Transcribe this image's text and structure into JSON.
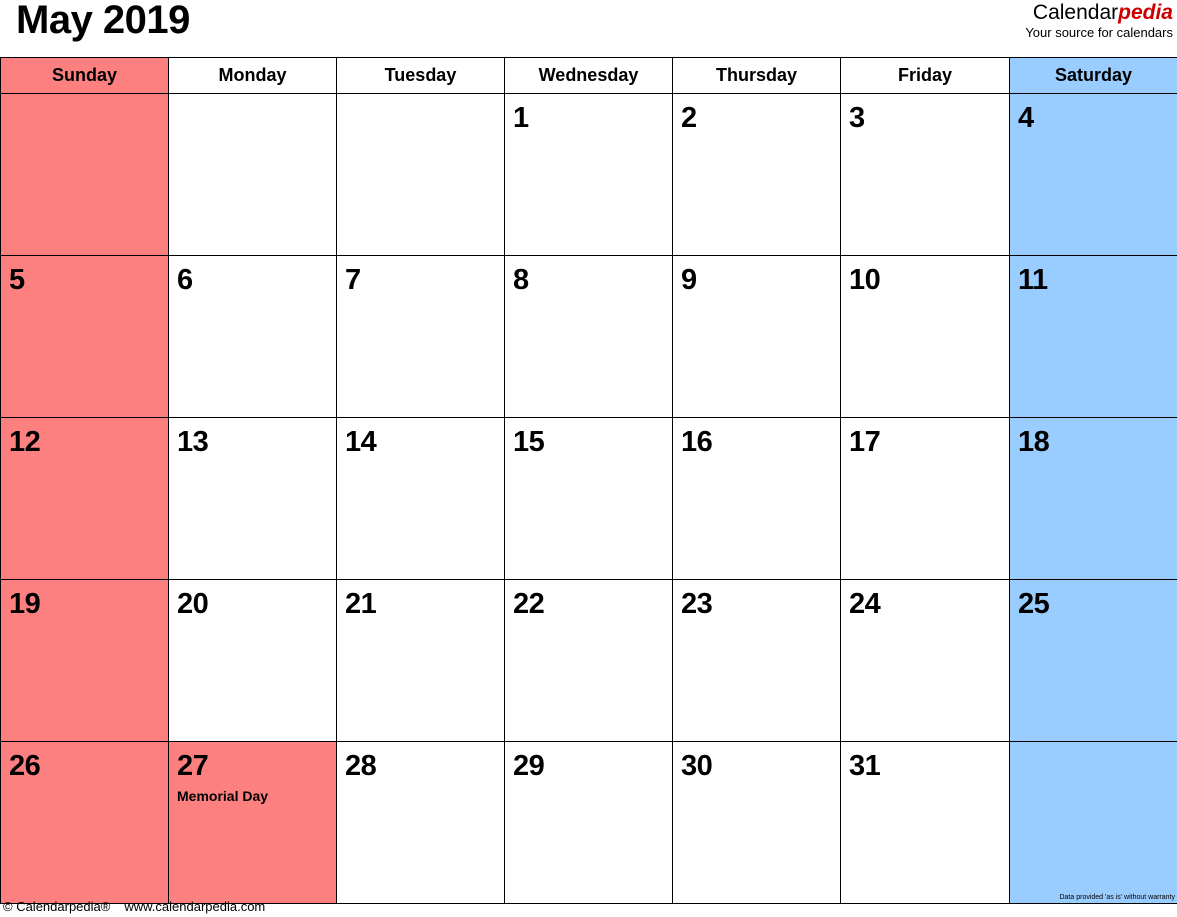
{
  "header": {
    "title": "May 2019",
    "brand_part1": "Calendar",
    "brand_part2": "pedia",
    "tagline": "Your source for calendars"
  },
  "colors": {
    "weekend_red": "#fd8080",
    "saturday_blue": "#99ccff",
    "brand_red": "#cc0000",
    "text": "#000000",
    "border": "#000000"
  },
  "calendar": {
    "month": "May",
    "year": "2019",
    "weekdays": [
      "Sunday",
      "Monday",
      "Tuesday",
      "Wednesday",
      "Thursday",
      "Friday",
      "Saturday"
    ],
    "weeks": [
      [
        {
          "day": "",
          "event": ""
        },
        {
          "day": "",
          "event": ""
        },
        {
          "day": "",
          "event": ""
        },
        {
          "day": "1",
          "event": ""
        },
        {
          "day": "2",
          "event": ""
        },
        {
          "day": "3",
          "event": ""
        },
        {
          "day": "4",
          "event": ""
        }
      ],
      [
        {
          "day": "5",
          "event": ""
        },
        {
          "day": "6",
          "event": ""
        },
        {
          "day": "7",
          "event": ""
        },
        {
          "day": "8",
          "event": ""
        },
        {
          "day": "9",
          "event": ""
        },
        {
          "day": "10",
          "event": ""
        },
        {
          "day": "11",
          "event": ""
        }
      ],
      [
        {
          "day": "12",
          "event": ""
        },
        {
          "day": "13",
          "event": ""
        },
        {
          "day": "14",
          "event": ""
        },
        {
          "day": "15",
          "event": ""
        },
        {
          "day": "16",
          "event": ""
        },
        {
          "day": "17",
          "event": ""
        },
        {
          "day": "18",
          "event": ""
        }
      ],
      [
        {
          "day": "19",
          "event": ""
        },
        {
          "day": "20",
          "event": ""
        },
        {
          "day": "21",
          "event": ""
        },
        {
          "day": "22",
          "event": ""
        },
        {
          "day": "23",
          "event": ""
        },
        {
          "day": "24",
          "event": ""
        },
        {
          "day": "25",
          "event": ""
        }
      ],
      [
        {
          "day": "26",
          "event": ""
        },
        {
          "day": "27",
          "event": "Memorial Day"
        },
        {
          "day": "28",
          "event": ""
        },
        {
          "day": "29",
          "event": ""
        },
        {
          "day": "30",
          "event": ""
        },
        {
          "day": "31",
          "event": ""
        },
        {
          "day": "",
          "event": ""
        }
      ]
    ],
    "disclaimer": "Data provided 'as is' without warranty"
  },
  "footer": {
    "copyright": "© Calendarpedia®",
    "website": "www.calendarpedia.com"
  }
}
